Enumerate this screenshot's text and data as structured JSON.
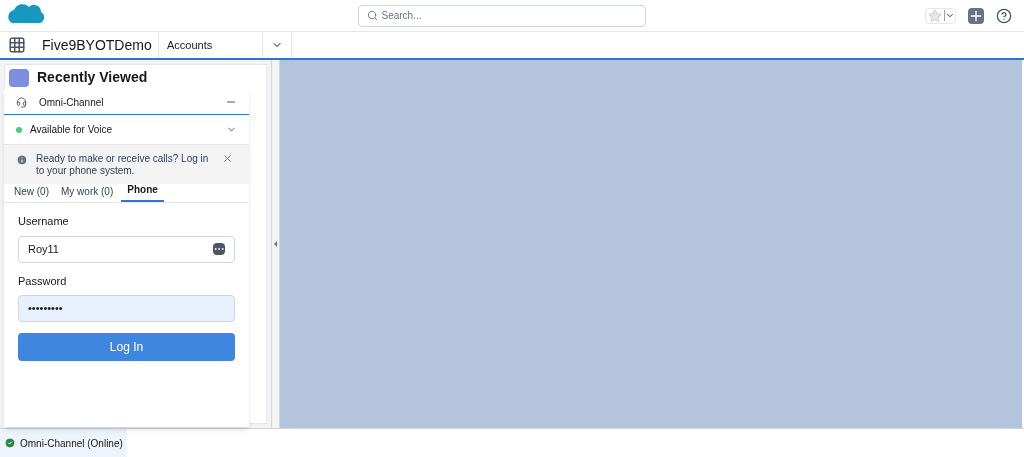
{
  "header": {
    "search": {
      "placeholder": "Search..."
    }
  },
  "nav": {
    "app_name": "Five9BYOTDemo",
    "tabs": [
      {
        "label": "Accounts",
        "selected": false
      }
    ]
  },
  "list_view": {
    "title": "Recently Viewed"
  },
  "omni_channel": {
    "title": "Omni-Channel",
    "status": "Available for Voice",
    "notice": "Ready to make or receive calls? Log in to your phone system.",
    "tabs": [
      {
        "label": "New (0)",
        "selected": false
      },
      {
        "label": "My work (0)",
        "selected": false
      },
      {
        "label": "Phone",
        "selected": true
      }
    ],
    "username": {
      "label": "Username",
      "value": "Roy11"
    },
    "password": {
      "label": "Password",
      "value": "•••••••••"
    },
    "login_button": "Log In"
  },
  "footer": {
    "utility": "Omni-Channel (Online)"
  }
}
